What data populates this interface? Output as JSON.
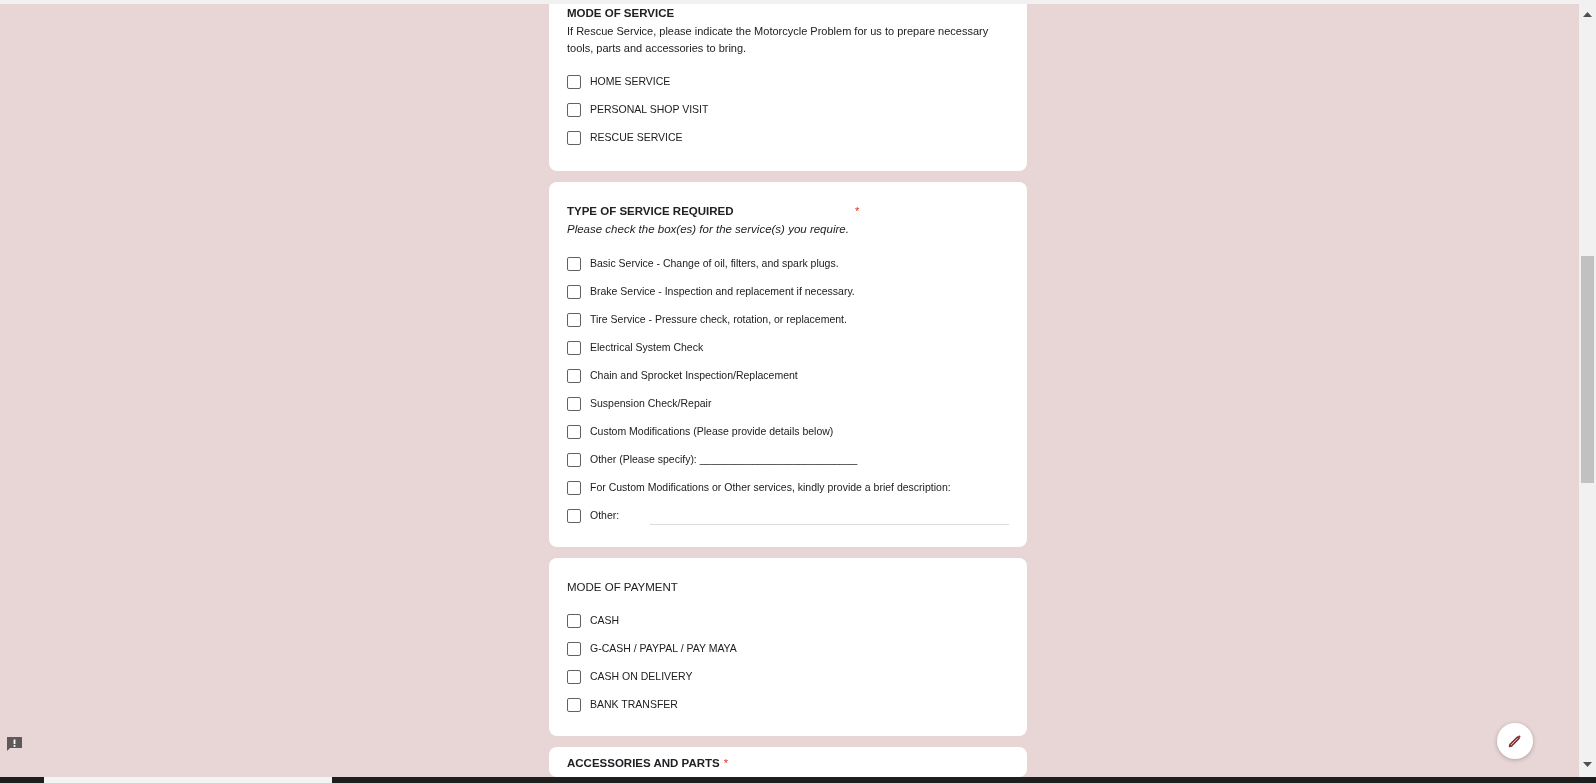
{
  "cards": [
    {
      "title": "MODE OF SERVICE",
      "title_bold": true,
      "description": "If Rescue Service, please indicate the Motorcycle Problem for us to prepare necessary tools, parts and accessories to bring.",
      "description_italic": false,
      "options": [
        {
          "kind": "checkbox",
          "label": "HOME SERVICE",
          "checked": false
        },
        {
          "kind": "checkbox",
          "label": "PERSONAL SHOP VISIT",
          "checked": false
        },
        {
          "kind": "checkbox",
          "label": "RESCUE SERVICE",
          "checked": false
        }
      ]
    },
    {
      "title": "TYPE OF SERVICE REQUIRED",
      "title_bold": true,
      "side_mark": "*",
      "description": "Please check the box(es) for the service(s) you require.",
      "description_italic": true,
      "options": [
        {
          "kind": "checkbox",
          "label": "Basic Service - Change of oil, filters, and spark plugs.",
          "checked": false
        },
        {
          "kind": "checkbox",
          "label": "Brake Service - Inspection and replacement if necessary.",
          "checked": false
        },
        {
          "kind": "checkbox",
          "label": "Tire Service - Pressure check, rotation, or replacement.",
          "checked": false
        },
        {
          "kind": "checkbox",
          "label": "Electrical System Check",
          "checked": false
        },
        {
          "kind": "checkbox",
          "label": "Chain and Sprocket Inspection/Replacement",
          "checked": false
        },
        {
          "kind": "checkbox",
          "label": "Suspension Check/Repair",
          "checked": false
        },
        {
          "kind": "checkbox",
          "label": "Custom Modifications (Please provide details below)",
          "checked": false
        },
        {
          "kind": "checkbox",
          "label": "Other (Please specify): ___________________________",
          "checked": false
        },
        {
          "kind": "checkbox",
          "label": "For Custom Modifications or Other services, kindly provide a brief description:",
          "checked": false
        },
        {
          "kind": "other",
          "label": "Other:",
          "checked": false
        }
      ]
    },
    {
      "title": "MODE OF PAYMENT",
      "title_bold": false,
      "options": [
        {
          "kind": "checkbox",
          "label": "CASH",
          "checked": false
        },
        {
          "kind": "checkbox",
          "label": "G-CASH / PAYPAL / PAY MAYA",
          "checked": false
        },
        {
          "kind": "checkbox",
          "label": "CASH ON DELIVERY",
          "checked": false
        },
        {
          "kind": "checkbox",
          "label": "BANK TRANSFER",
          "checked": false
        }
      ]
    },
    {
      "title": "ACCESSORIES AND PARTS",
      "title_bold": true,
      "required_mark": "*"
    }
  ]
}
